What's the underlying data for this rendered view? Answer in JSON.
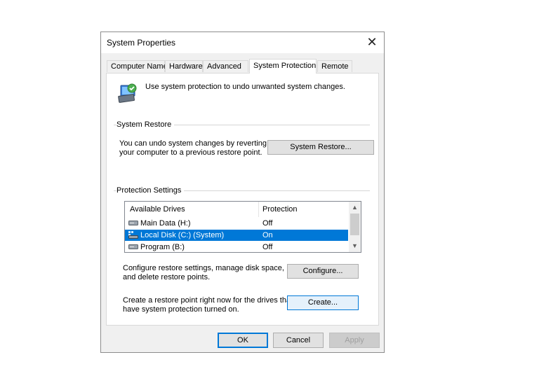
{
  "window": {
    "title": "System Properties",
    "close_label": "✕"
  },
  "tabs": [
    {
      "label": "Computer Name"
    },
    {
      "label": "Hardware"
    },
    {
      "label": "Advanced"
    },
    {
      "label": "System Protection",
      "active": true
    },
    {
      "label": "Remote"
    }
  ],
  "intro": {
    "text": "Use system protection to undo unwanted system changes.",
    "icon": "system-protection-icon"
  },
  "system_restore": {
    "group_label": "System Restore",
    "description_line1": "You can undo system changes by reverting",
    "description_line2": "your computer to a previous restore point.",
    "button_label": "System Restore..."
  },
  "protection_settings": {
    "group_label": "Protection Settings",
    "columns": [
      "Available Drives",
      "Protection"
    ],
    "drives": [
      {
        "name": "Main Data (H:)",
        "protection": "Off",
        "icon": "drive-icon"
      },
      {
        "name": "Local Disk (C:) (System)",
        "protection": "On",
        "icon": "system-drive-icon",
        "selected": true
      },
      {
        "name": "Program (B:)",
        "protection": "Off",
        "icon": "drive-icon"
      }
    ],
    "configure_line1": "Configure restore settings, manage disk space,",
    "configure_line2": "and delete restore points.",
    "configure_button": "Configure...",
    "create_line1": "Create a restore point right now for the drives that",
    "create_line2": "have system protection turned on.",
    "create_button": "Create..."
  },
  "footer": {
    "ok": "OK",
    "cancel": "Cancel",
    "apply": "Apply"
  },
  "colors": {
    "selection": "#0078d7",
    "dialog_bg": "#f0f0f0",
    "panel_bg": "#ffffff"
  }
}
